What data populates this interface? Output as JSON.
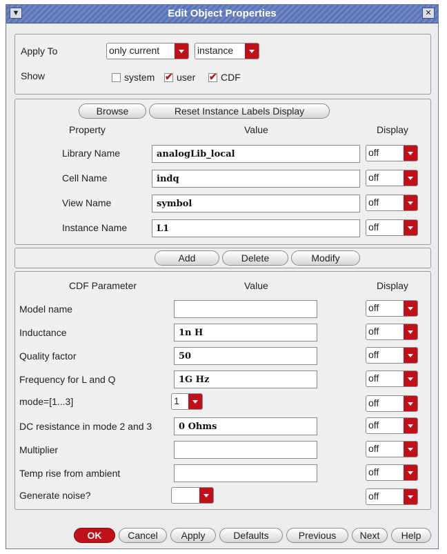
{
  "window": {
    "title": "Edit Object Properties",
    "menu_icon": "chevron-down-icon",
    "close_icon": "close-icon"
  },
  "apply": {
    "label": "Apply To",
    "scope": "only current",
    "type": "instance",
    "show_label": "Show",
    "show": [
      {
        "label": "system",
        "checked": false
      },
      {
        "label": "user",
        "checked": true
      },
      {
        "label": "CDF",
        "checked": true
      }
    ]
  },
  "props": {
    "browse": "Browse",
    "reset": "Reset Instance Labels Display",
    "h_property": "Property",
    "h_value": "Value",
    "h_display": "Display",
    "rows": [
      {
        "label": "Library Name",
        "value": "analogLib_local",
        "display": "off"
      },
      {
        "label": "Cell Name",
        "value": "indq",
        "display": "off"
      },
      {
        "label": "View Name",
        "value": "symbol",
        "display": "off"
      },
      {
        "label": "Instance Name",
        "value": "L1",
        "display": "off"
      }
    ]
  },
  "actions": {
    "add": "Add",
    "delete": "Delete",
    "modify": "Modify"
  },
  "cdf": {
    "h_param": "CDF Parameter",
    "h_value": "Value",
    "h_display": "Display",
    "rows": [
      {
        "label": "Model name",
        "value": "",
        "display": "off"
      },
      {
        "label": "Inductance",
        "value": "1n H",
        "display": "off"
      },
      {
        "label": "Quality factor",
        "value": "50",
        "display": "off"
      },
      {
        "label": "Frequency for L and Q",
        "value": "1G Hz",
        "display": "off"
      },
      {
        "label": "mode=[1...3]",
        "value": "1",
        "display": "off"
      },
      {
        "label": "DC resistance in mode 2 and 3",
        "value": "0 Ohms",
        "display": "off"
      },
      {
        "label": "Multiplier",
        "value": "",
        "display": "off"
      },
      {
        "label": "Temp rise from ambient",
        "value": "",
        "display": "off"
      },
      {
        "label": "Generate noise?",
        "value": "",
        "display": "off"
      }
    ]
  },
  "footer": {
    "ok": "OK",
    "cancel": "Cancel",
    "apply": "Apply",
    "defaults": "Defaults",
    "previous": "Previous",
    "next": "Next",
    "help": "Help"
  }
}
